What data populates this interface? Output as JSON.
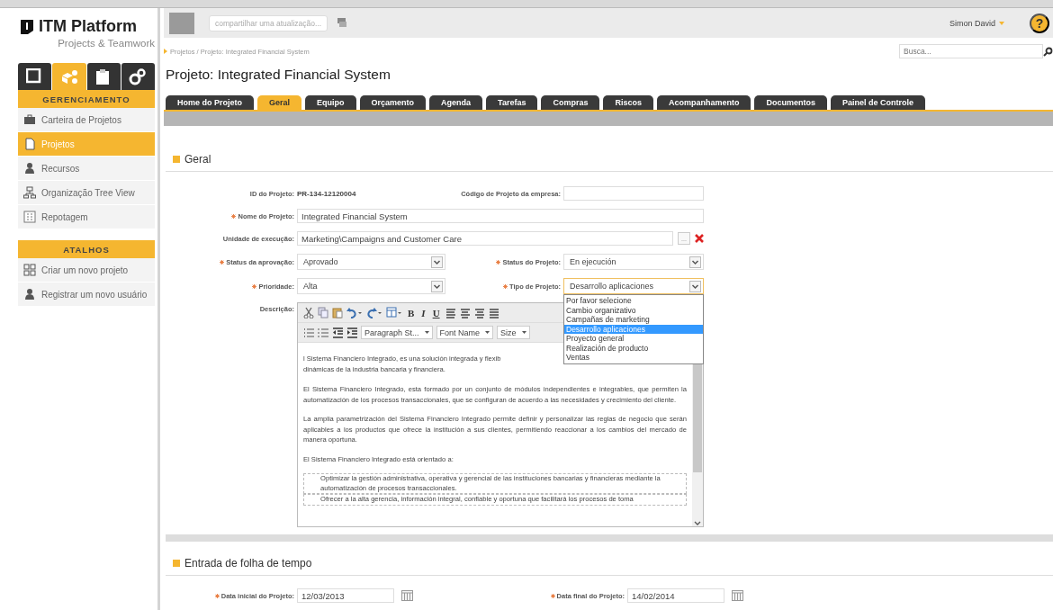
{
  "sidebar": {
    "logo": {
      "title": "ITM Platform",
      "subtitle": "Projects & Teamwork"
    },
    "modules": [
      {
        "kind": "window",
        "selected": false
      },
      {
        "kind": "boxes",
        "selected": true
      },
      {
        "kind": "clipboard",
        "selected": false
      },
      {
        "kind": "gears",
        "selected": false
      }
    ],
    "sections": [
      {
        "title": "GERENCIAMENTO",
        "items": [
          {
            "label": "Carteira de Projetos",
            "kind": "briefcase",
            "selected": false
          },
          {
            "label": "Projetos",
            "kind": "document",
            "selected": true
          },
          {
            "label": "Recursos",
            "kind": "person",
            "selected": false
          },
          {
            "label": "Organização Tree View",
            "kind": "orgchart",
            "selected": false
          },
          {
            "label": "Repotagem",
            "kind": "report",
            "selected": false
          }
        ]
      },
      {
        "title": "ATALHOS",
        "items": [
          {
            "label": "Criar um novo projeto",
            "kind": "grid",
            "selected": false
          },
          {
            "label": "Registrar um novo usuário",
            "kind": "person",
            "selected": false
          }
        ]
      }
    ]
  },
  "topbar": {
    "share": {
      "placeholder": "compartilhar uma atualização..."
    },
    "user": "Simon David",
    "help": "?"
  },
  "breadcrumb": "Projetos / Projeto: Integrated Financial System",
  "search": {
    "placeholder": "Busca..."
  },
  "title": "Projeto: Integrated Financial System",
  "tabs": [
    {
      "label": "Home do Projeto",
      "selected": false
    },
    {
      "label": "Geral",
      "selected": true
    },
    {
      "label": "Equipo",
      "selected": false
    },
    {
      "label": "Orçamento",
      "selected": false
    },
    {
      "label": "Agenda",
      "selected": false
    },
    {
      "label": "Tarefas",
      "selected": false
    },
    {
      "label": "Compras",
      "selected": false
    },
    {
      "label": "Riscos",
      "selected": false
    },
    {
      "label": "Acompanhamento",
      "selected": false
    },
    {
      "label": "Documentos",
      "selected": false
    },
    {
      "label": "Painel de Controle",
      "selected": false
    }
  ],
  "general": {
    "title": "Geral",
    "rows": [
      [
        {
          "kind": "readonly",
          "label": "ID do Projeto:",
          "required": false,
          "value": "PR-134-12120004"
        },
        {
          "kind": "text",
          "label": "Código de Projeto da empresa:",
          "required": false
        }
      ],
      [
        {
          "kind": "text",
          "label": "Nome do Projeto:",
          "required": true,
          "value": "Integrated Financial System"
        }
      ],
      [
        {
          "kind": "text",
          "label": "Unidade de execução:",
          "required": false,
          "value": "Marketing\\Campaigns and Customer Care",
          "browse": "...",
          "clearable": true
        }
      ],
      [
        {
          "kind": "select",
          "label": "Status da aprovação:",
          "required": true,
          "value": "Aprovado",
          "focused": false
        },
        {
          "kind": "select",
          "label": "Status do Projeto:",
          "required": true,
          "value": "En ejecución",
          "focused": false
        }
      ],
      [
        {
          "kind": "select",
          "label": "Prioridade:",
          "required": true,
          "value": "Alta",
          "focused": false
        },
        {
          "kind": "select",
          "label": "Tipo de Projeto:",
          "required": true,
          "value": "Desarrollo aplicaciones",
          "focused": true,
          "open": true,
          "options": [
            {
              "label": "Por favor selecione",
              "selected": false
            },
            {
              "label": "Cambio organizativo",
              "selected": false
            },
            {
              "label": "Campañas de marketing",
              "selected": false
            },
            {
              "label": "Desarrollo aplicaciones",
              "selected": true
            },
            {
              "label": "Proyecto general",
              "selected": false
            },
            {
              "label": "Realización de producto",
              "selected": false
            },
            {
              "label": "Ventas",
              "selected": false
            }
          ]
        }
      ],
      [
        {
          "kind": "editor",
          "label": "Descrição:",
          "required": false,
          "toolbar": {
            "text_buttons": [
              "B",
              "I",
              "U"
            ],
            "dropdowns": [
              "Paragraph St...",
              "Font Name",
              "Size"
            ]
          },
          "content": [
            {
              "kind": "line",
              "text": "l Sistema Financiero Integrado, es una solución integrada y flexib"
            },
            {
              "kind": "line",
              "text": "dinámicas de la industria bancaria y financiera."
            },
            {
              "kind": "paragraph",
              "text": "El Sistema Financiero Integrado, esta formado por un conjunto de módulos independientes e integrables, que permiten la automatización de los procesos transaccionales, que se configuran de acuerdo a las necesidades y crecimiento del cliente."
            },
            {
              "kind": "paragraph",
              "text": "La amplia parametrización del Sistema Financiero Integrado permite definir y personalizar las reglas de negocio que serán aplicables a los productos que ofrece la institución a sus clientes, permitiendo reaccionar a los cambios del mercado de manera oportuna."
            },
            {
              "kind": "paragraph",
              "text": "El Sistema Financiero Integrado está orientado a:"
            },
            {
              "kind": "list",
              "items": [
                "Optimizar la gestión administrativa, operativa y gerencial de las instituciones bancarias y financieras mediante la automatización de procesos transaccionales.",
                "Ofrecer a la alta gerencia, información integral, confiable y oportuna que facilitará los procesos de toma"
              ]
            }
          ]
        }
      ]
    ]
  },
  "timesheet": {
    "title": "Entrada de folha de tempo",
    "fields": [
      {
        "label": "Data inicial do Projeto:",
        "required": true,
        "value": "12/03/2013"
      },
      {
        "label": "Data final do Projeto:",
        "required": true,
        "value": "14/02/2014"
      }
    ]
  }
}
